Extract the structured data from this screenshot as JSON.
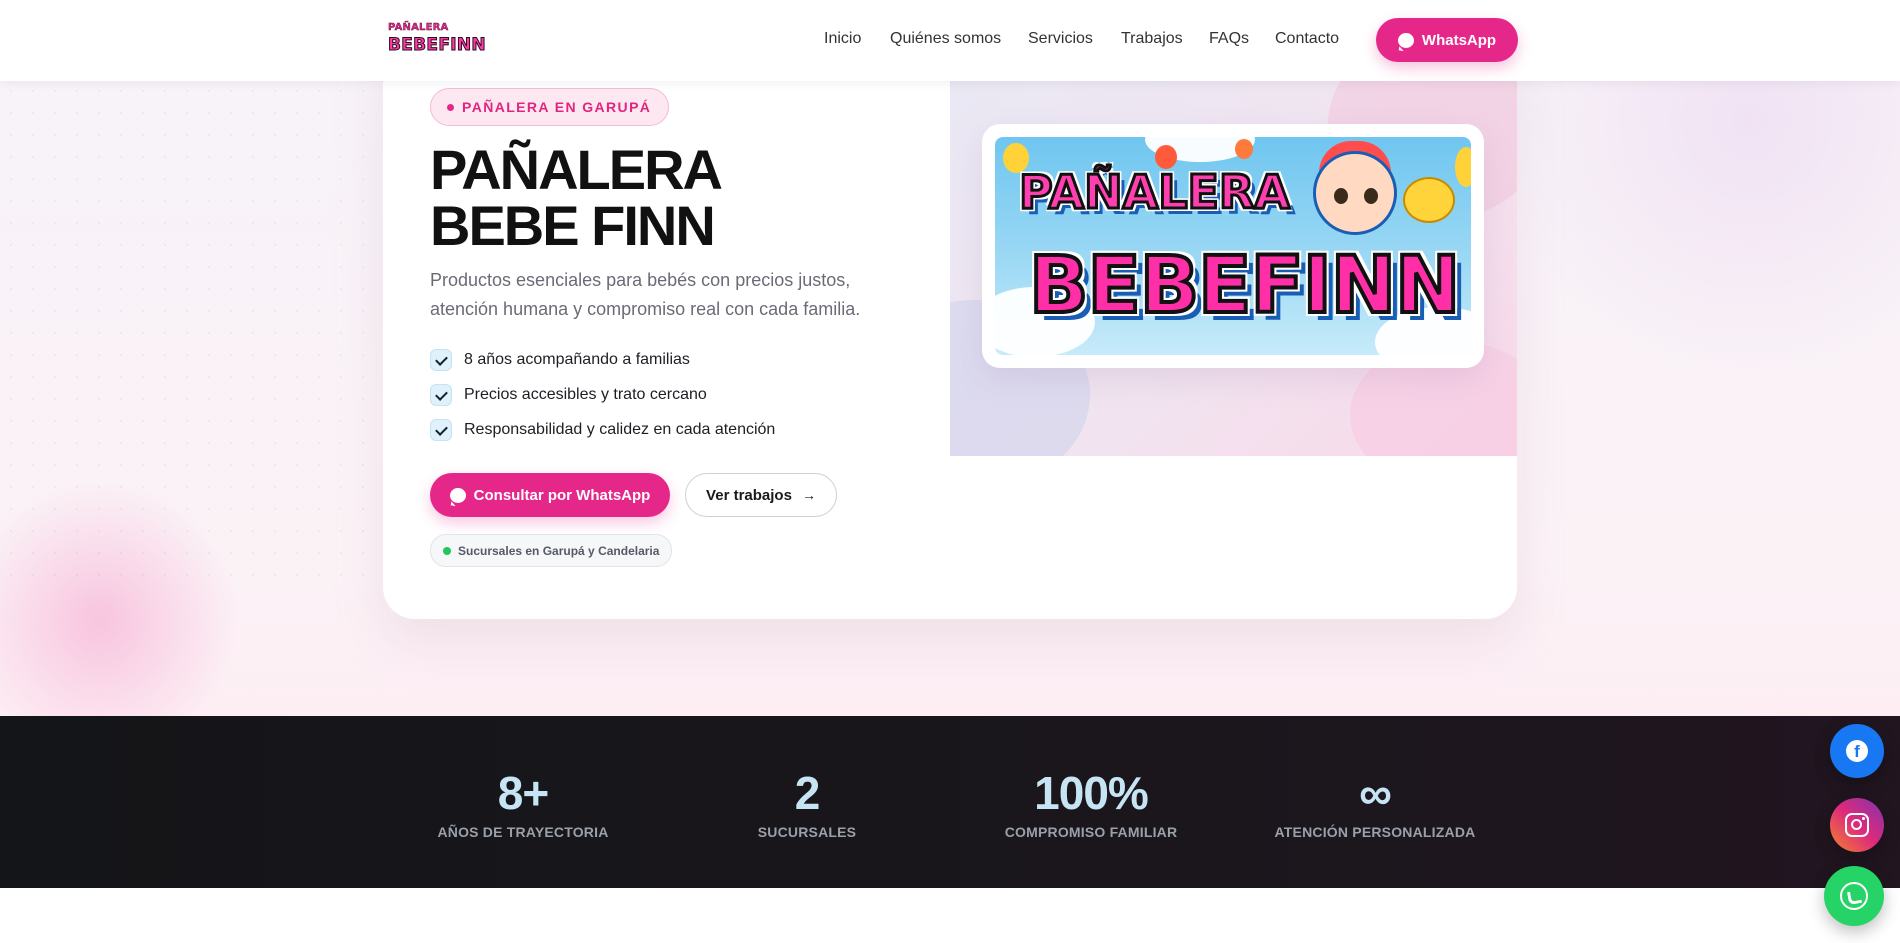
{
  "header": {
    "logo": {
      "line1": "PAÑALERA",
      "line2": "BEBEFINN"
    },
    "nav": [
      "Inicio",
      "Quiénes somos",
      "Servicios",
      "Trabajos",
      "FAQs",
      "Contacto"
    ],
    "cta_label": "WhatsApp",
    "cta_icon": "chat-bubble-icon"
  },
  "hero": {
    "eyebrow": "PAÑALERA EN GARUPÁ",
    "title_line1": "PAÑALERA",
    "title_line2": "BEBE FINN",
    "subtitle": "Productos esenciales para bebés con precios justos, atención humana y compromiso real con cada familia.",
    "checks": [
      "8 años acompañando a familias",
      "Precios accesibles y trato cercano",
      "Responsabilidad y calidez en cada atención"
    ],
    "primary_button": "Consultar por WhatsApp",
    "secondary_button": "Ver trabajos",
    "secondary_icon": "arrow-right-icon",
    "branch_chip": "Sucursales en Garupá y Candelaria",
    "banner": {
      "line1": "PAÑALERA",
      "line2": "BEBEFINN"
    }
  },
  "stats": [
    {
      "value": "8+",
      "label": "AÑOS DE TRAYECTORIA"
    },
    {
      "value": "2",
      "label": "SUCURSALES"
    },
    {
      "value": "100%",
      "label": "COMPROMISO FAMILIAR"
    },
    {
      "value": "∞",
      "label": "ATENCIÓN PERSONALIZADA"
    }
  ],
  "floating": [
    "facebook-icon",
    "instagram-icon",
    "whatsapp-icon"
  ],
  "colors": {
    "brand_pink": "#e6278a",
    "stats_bg": "#141518",
    "stat_number": "#c7e4f4",
    "whatsapp_green": "#25d366",
    "facebook_blue": "#1877f2"
  }
}
